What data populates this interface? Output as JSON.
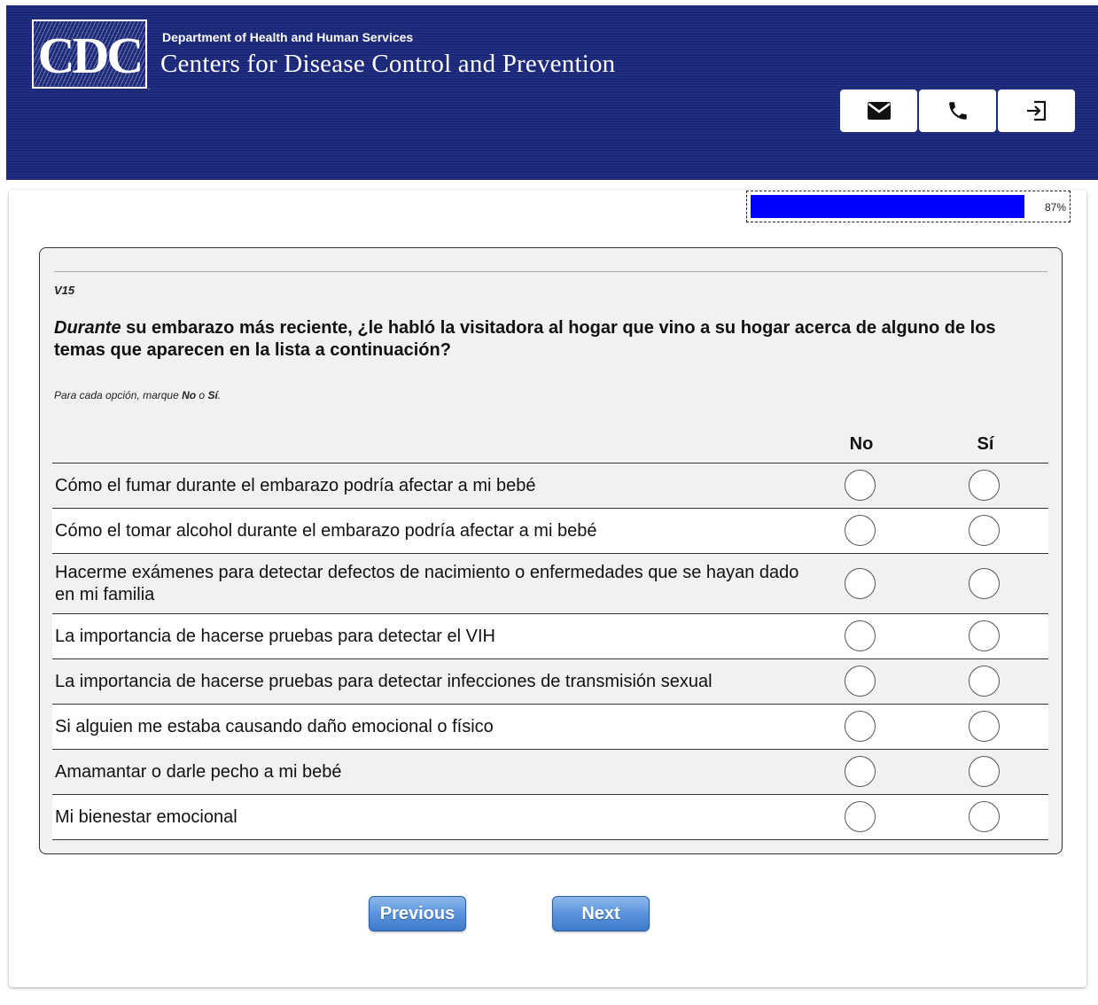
{
  "header": {
    "logo_text": "CDC",
    "department": "Department of Health and Human Services",
    "organization": "Centers for Disease Control and Prevention",
    "buttons": [
      {
        "icon": "mail-icon"
      },
      {
        "icon": "phone-icon"
      },
      {
        "icon": "exit-icon"
      }
    ]
  },
  "progress": {
    "value": 0.87,
    "label": "87%"
  },
  "question": {
    "id": "V15",
    "text_emphasis": "Durante",
    "text_rest": " su embarazo más reciente, ¿le habló la visitadora al hogar que vino a su hogar acerca de alguno de los temas que aparecen en la lista a continuación?",
    "instruction_prefix": "Para cada opción, marque ",
    "instruction_no": "No",
    "instruction_mid": " o ",
    "instruction_si": "Sí",
    "instruction_suffix": ".",
    "col_no": "No",
    "col_si": "Sí",
    "items": [
      {
        "label": "Cómo el fumar durante el embarazo podría afectar a mi bebé"
      },
      {
        "label": "Cómo el tomar alcohol durante el embarazo podría afectar a mi bebé"
      },
      {
        "label": "Hacerme exámenes para detectar defectos de nacimiento o enfermedades que se hayan dado en mi familia"
      },
      {
        "label": "La importancia de hacerse pruebas para detectar el VIH"
      },
      {
        "label": "La importancia de hacerse pruebas para detectar infecciones de transmisión sexual"
      },
      {
        "label": "Si alguien me estaba causando daño emocional o físico"
      },
      {
        "label": "Amamantar o darle pecho a mi bebé"
      },
      {
        "label": "Mi bienestar emocional"
      }
    ]
  },
  "nav": {
    "previous": "Previous",
    "next": "Next"
  },
  "colors": {
    "header_bg": "#1f2d7d",
    "progress_fill": "#0000ff",
    "button_blue": "#5a93dc"
  }
}
